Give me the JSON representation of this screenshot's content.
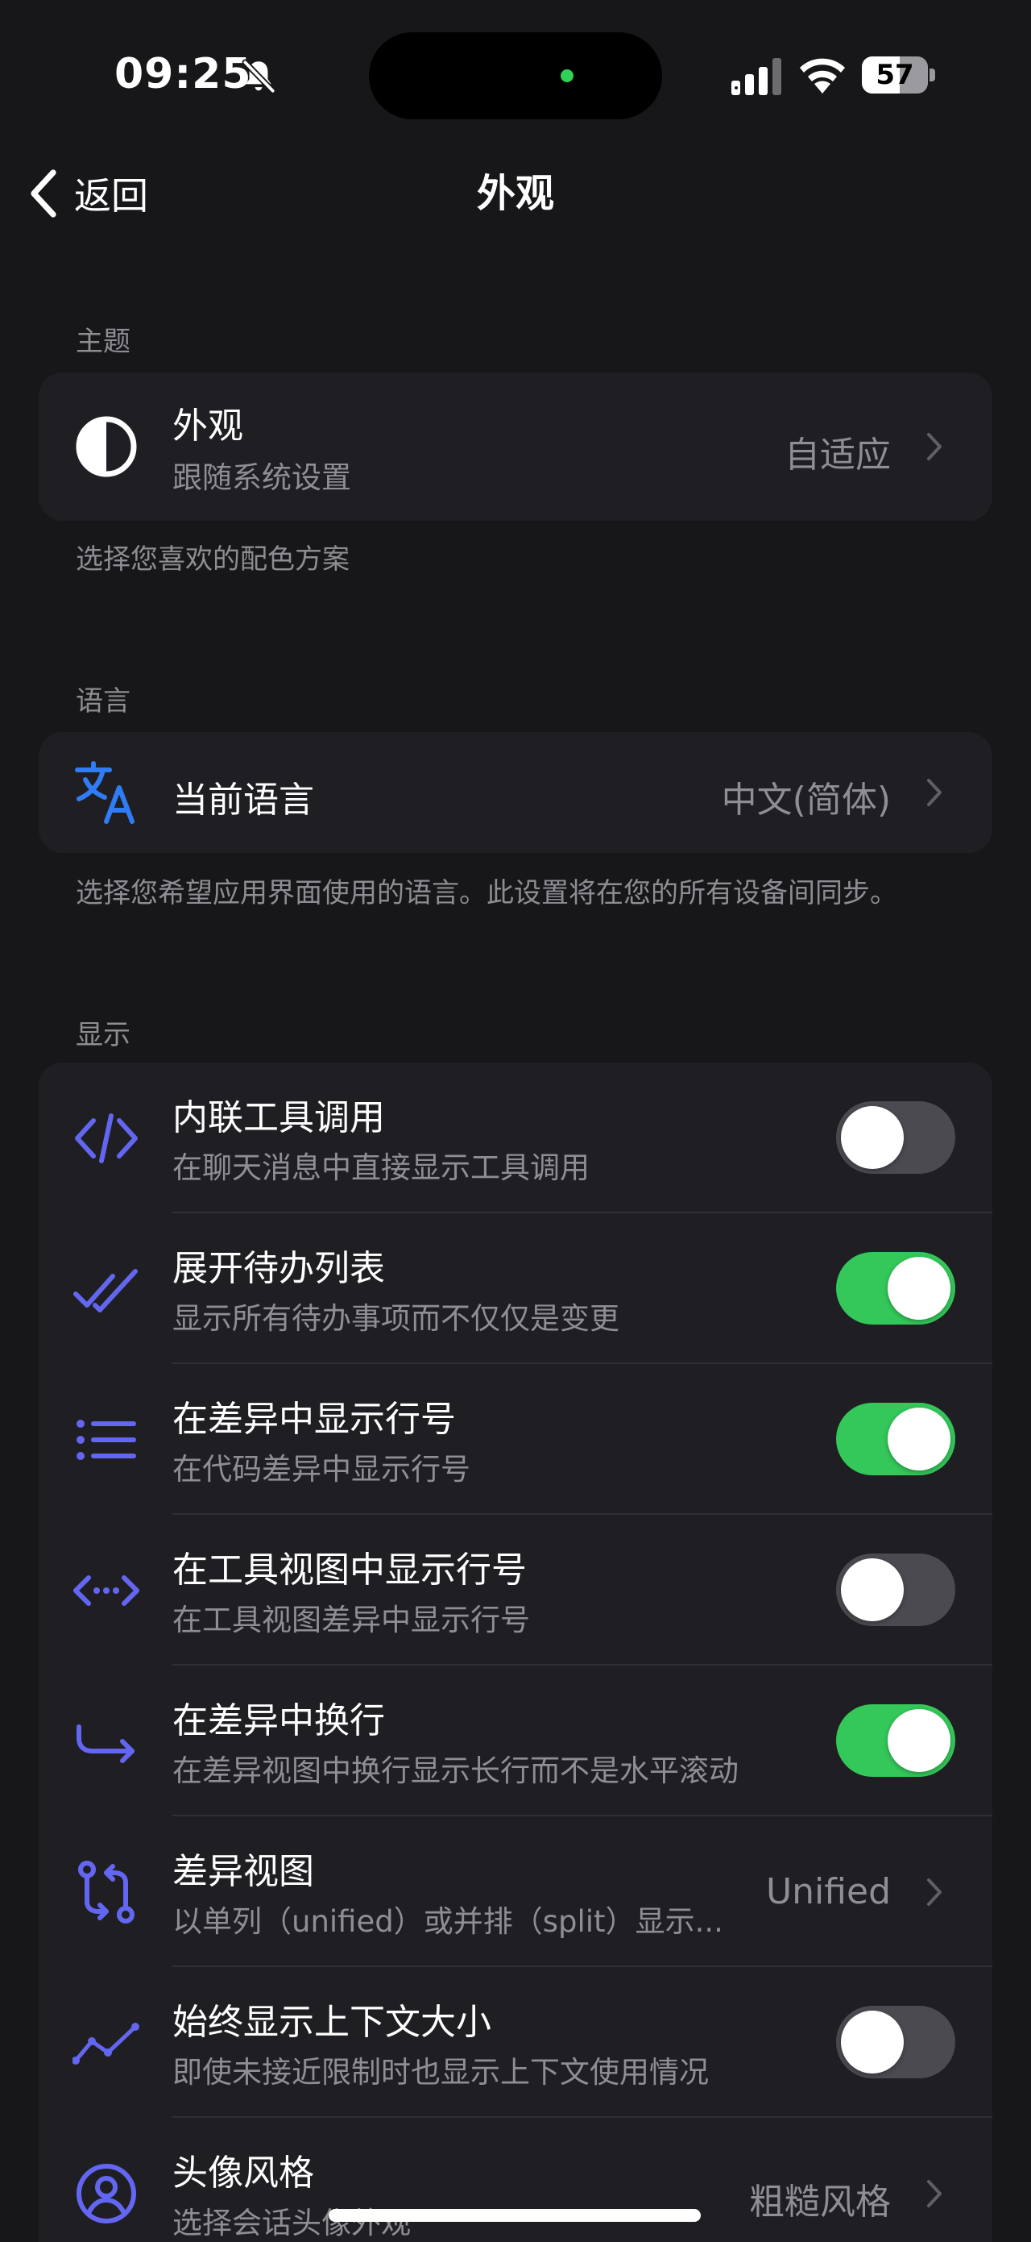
{
  "status": {
    "time": "09:25",
    "battery": "57",
    "battery_level": 0.57
  },
  "nav": {
    "back_label": "返回",
    "title": "外观"
  },
  "colors": {
    "accent_blue": "#2f7cf6",
    "icon_indigo": "#6366f1",
    "toggle_on": "#34c759",
    "toggle_off": "#4a4a50"
  },
  "theme": {
    "header": "主题",
    "row": {
      "icon": "half-circle-icon",
      "title": "外观",
      "subtitle": "跟随系统设置",
      "value": "自适应"
    },
    "footnote": "选择您喜欢的配色方案"
  },
  "language": {
    "header": "语言",
    "row": {
      "icon": "translate-icon",
      "title": "当前语言",
      "value": "中文(简体)"
    },
    "footnote": "选择您希望应用界面使用的语言。此设置将在您的所有设备间同步。"
  },
  "display": {
    "header": "显示",
    "items": [
      {
        "icon": "code-icon",
        "title": "内联工具调用",
        "subtitle": "在聊天消息中直接显示工具调用",
        "toggle": false
      },
      {
        "icon": "double-check-icon",
        "title": "展开待办列表",
        "subtitle": "显示所有待办事项而不仅仅是变更",
        "toggle": true
      },
      {
        "icon": "list-icon",
        "title": "在差异中显示行号",
        "subtitle": "在代码差异中显示行号",
        "toggle": true
      },
      {
        "icon": "code-expand-icon",
        "title": "在工具视图中显示行号",
        "subtitle": "在工具视图差异中显示行号",
        "toggle": false
      },
      {
        "icon": "wrap-arrow-icon",
        "title": "在差异中换行",
        "subtitle": "在差异视图中换行显示长行而不是水平滚动",
        "toggle": true
      },
      {
        "icon": "git-compare-icon",
        "title": "差异视图",
        "subtitle": "以单列（unified）或并排（split）显示...",
        "value": "Unified"
      },
      {
        "icon": "trend-line-icon",
        "title": "始终显示上下文大小",
        "subtitle": "即使未接近限制时也显示上下文使用情况",
        "toggle": false
      },
      {
        "icon": "avatar-circle-icon",
        "title": "头像风格",
        "subtitle": "选择会话头像外观",
        "value": "粗糙风格"
      }
    ]
  }
}
